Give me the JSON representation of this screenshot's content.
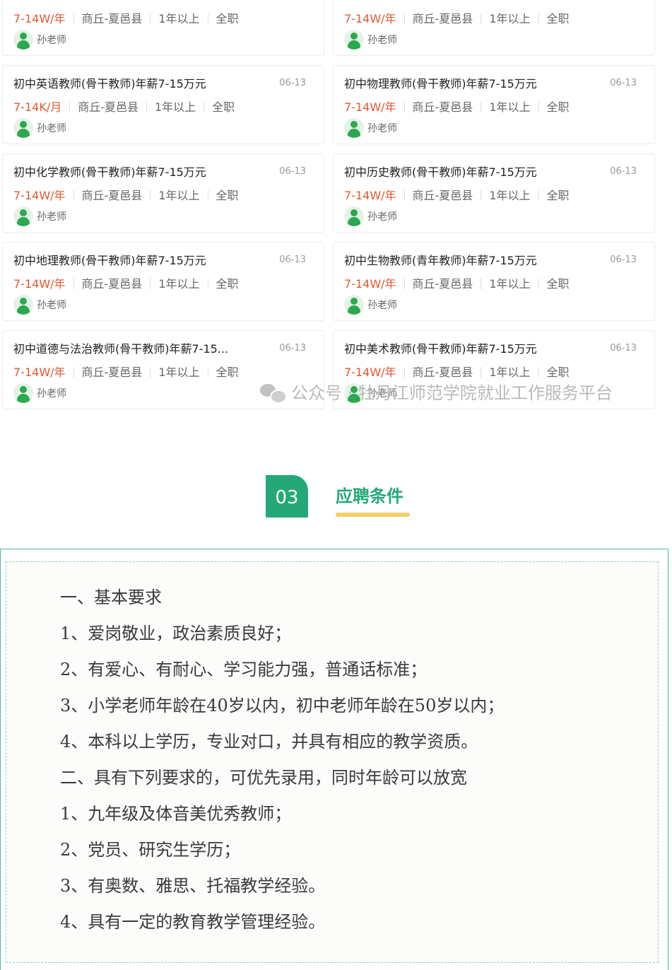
{
  "jobs": [
    {
      "title": "",
      "date": "",
      "salary": "7-14W/年",
      "location": "商丘-夏邑县",
      "experience": "1年以上",
      "type": "全职",
      "contact": "孙老师"
    },
    {
      "title": "",
      "date": "",
      "salary": "7-14W/年",
      "location": "商丘-夏邑县",
      "experience": "1年以上",
      "type": "全职",
      "contact": "孙老师"
    },
    {
      "title": "初中英语教师(骨干教师)年薪7-15万元",
      "date": "06-13",
      "salary": "7-14K/月",
      "location": "商丘-夏邑县",
      "experience": "1年以上",
      "type": "全职",
      "contact": "孙老师"
    },
    {
      "title": "初中物理教师(骨干教师)年薪7-15万元",
      "date": "06-13",
      "salary": "7-14W/年",
      "location": "商丘-夏邑县",
      "experience": "1年以上",
      "type": "全职",
      "contact": "孙老师"
    },
    {
      "title": "初中化学教师(骨干教师)年薪7-15万元",
      "date": "06-13",
      "salary": "7-14W/年",
      "location": "商丘-夏邑县",
      "experience": "1年以上",
      "type": "全职",
      "contact": "孙老师"
    },
    {
      "title": "初中历史教师(骨干教师)年薪7-15万元",
      "date": "06-13",
      "salary": "7-14W/年",
      "location": "商丘-夏邑县",
      "experience": "1年以上",
      "type": "全职",
      "contact": "孙老师"
    },
    {
      "title": "初中地理教师(骨干教师)年薪7-15万元",
      "date": "06-13",
      "salary": "7-14W/年",
      "location": "商丘-夏邑县",
      "experience": "1年以上",
      "type": "全职",
      "contact": "孙老师"
    },
    {
      "title": "初中生物教师(青年教师)年薪7-15万元",
      "date": "06-13",
      "salary": "7-14W/年",
      "location": "商丘-夏邑县",
      "experience": "1年以上",
      "type": "全职",
      "contact": "孙老师"
    },
    {
      "title": "初中道德与法治教师(骨干教师)年薪7-15...",
      "date": "06-13",
      "salary": "7-14W/年",
      "location": "商丘-夏邑县",
      "experience": "1年以上",
      "type": "全职",
      "contact": "孙老师"
    },
    {
      "title": "初中美术教师(骨干教师)年薪7-15万元",
      "date": "06-13",
      "salary": "7-14W/年",
      "location": "商丘-夏邑县",
      "experience": "1年以上",
      "type": "全职",
      "contact": "孙老师"
    }
  ],
  "watermark": "公众号 · 牡丹江师范学院就业工作服务平台",
  "section": {
    "number": "03",
    "title": "应聘条件"
  },
  "requirements": [
    "一、基本要求",
    "1、爱岗敬业，政治素质良好；",
    "2、有爱心、有耐心、学习能力强，普通话标准；",
    "3、小学老师年龄在40岁以内，初中老师年龄在50岁以内；",
    "4、本科以上学历，专业对口，并具有相应的教学资质。",
    "二、具有下列要求的，可优先录用，同时年龄可以放宽",
    "1、九年级及体音美优秀教师；",
    "2、党员、研究生学历；",
    "3、有奥数、雅思、托福教学经验。",
    "4、具有一定的教育教学管理经验。"
  ],
  "colors": {
    "salary": "#e2582f",
    "accent": "#24a878",
    "underline": "#f2cf6b",
    "border": "#4bb8b3"
  }
}
